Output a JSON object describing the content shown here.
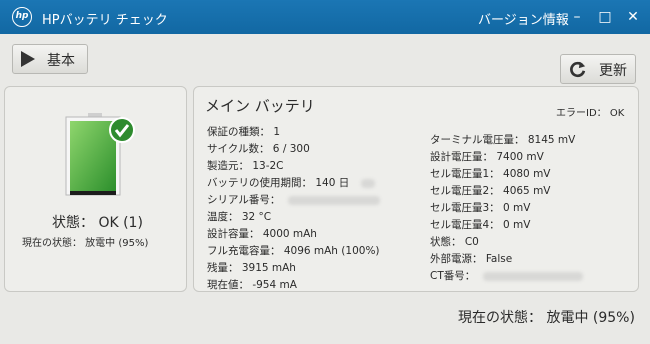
{
  "titlebar": {
    "logo_text": "hp",
    "app_title": "HPバッテリ チェック",
    "version_link": "バージョン情報",
    "minimize": "–",
    "maximize": "□",
    "close": "✕"
  },
  "toolbar": {
    "basic_label": "基本",
    "refresh_label": "更新"
  },
  "left_panel": {
    "status_label": "状態： OK (1)",
    "current_state_label": "現在の状態： 放電中 (95%)"
  },
  "main": {
    "title": "メイン バッテリ",
    "error_id": "エラーID： OK",
    "left_rows": [
      {
        "label": "保証の種類： 1"
      },
      {
        "label": "サイクル数： 6 / 300"
      },
      {
        "label": "製造元： 13-2C"
      },
      {
        "label": "バッテリの使用期間： 140 日"
      },
      {
        "label": "シリアル番号："
      },
      {
        "label": "温度： 32 °C"
      },
      {
        "label": "設計容量： 4000 mAh"
      },
      {
        "label": "フル充電容量： 4096 mAh (100%)"
      },
      {
        "label": "残量： 3915 mAh"
      },
      {
        "label": "現在値： -954 mA"
      }
    ],
    "right_rows": [
      {
        "label": "ターミナル電圧量： 8145 mV"
      },
      {
        "label": "設計電圧量： 7400 mV"
      },
      {
        "label": "セル電圧量1： 4080 mV"
      },
      {
        "label": "セル電圧量2： 4065 mV"
      },
      {
        "label": "セル電圧量3： 0 mV"
      },
      {
        "label": "セル電圧量4： 0 mV"
      },
      {
        "label": "状態： C0"
      },
      {
        "label": "外部電源： False"
      },
      {
        "label": "CT番号："
      }
    ]
  },
  "footer": {
    "current_state": "現在の状態： 放電中 (95%)"
  },
  "colors": {
    "titlebar": "#1b76b4",
    "battery_green": "#3aa43a",
    "check_green": "#2e8b2e"
  },
  "icons": {
    "basic": "play-icon",
    "refresh": "refresh-icon",
    "battery": "battery-icon",
    "check": "checkmark-icon"
  }
}
